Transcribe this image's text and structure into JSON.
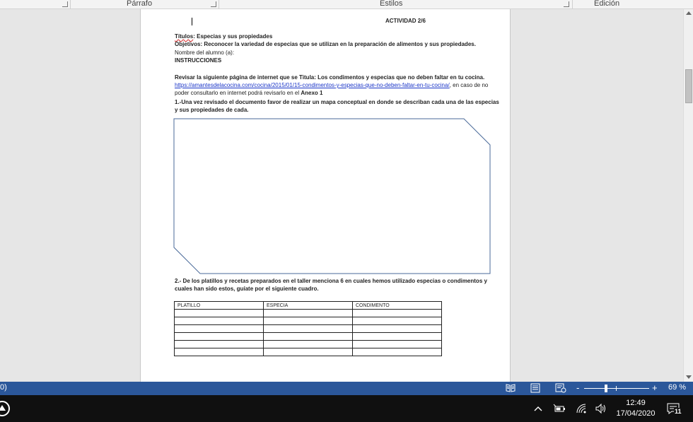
{
  "ribbon": {
    "groups": [
      {
        "label": "Párrafo"
      },
      {
        "label": "Estilos"
      },
      {
        "label": "Edición"
      }
    ]
  },
  "document": {
    "header_activity": "ACTIVIDAD 2/6",
    "title_label": "Títulos",
    "title_text": ": Especias y sus propiedades",
    "objectives_label": "Objetivos:",
    "objectives_text": " Reconocer la variedad de especias que se utilizan en la preparación de alimentos y sus propiedades.",
    "student_name_label": "Nombre del alumno (a):",
    "instructions_heading": "INSTRUCCIONES",
    "review_text": "Revisar la siguiente página de internet que se Titula: Los condimentos y especias que no deben faltar en tu cocina.",
    "link_url": "https://amantesdelacocina.com/cocina/2015/01/15-condimentos-y-especias-que-no-deben-faltar-en-tu-cocina/",
    "link_after": ", en caso de no poder consultarlo en internet podrá revisarlo en el ",
    "annex": "Anexo 1",
    "q1": "1.-Una vez revisado el documento favor de realizar un mapa conceptual en donde se describan cada una de las especias y sus propiedades de cada.",
    "q2": "2.- De los platillos y recetas preparados en el taller menciona 6 en cuales hemos utilizado especias o condimentos y cuales han sido estos, guíate por el siguiente cuadro.",
    "table": {
      "headers": [
        "PLATILLO",
        "ESPECIA",
        "CONDIMENTO"
      ],
      "empty_rows": 6
    }
  },
  "statusbar": {
    "left_fragment": "0)",
    "view_icons": [
      "read-mode-icon",
      "print-layout-icon",
      "web-layout-icon"
    ],
    "zoom_minus": "-",
    "zoom_plus": "+",
    "zoom_percent": 69,
    "zoom_label": "69 %"
  },
  "taskbar": {
    "time": "12:49",
    "date": "17/04/2020",
    "notification_count": "11",
    "tray_icons": [
      "chevron-up-icon",
      "battery-icon",
      "wifi-icon",
      "speaker-icon",
      "action-center-icon"
    ]
  },
  "colors": {
    "statusbar_bg": "#2b579a",
    "link": "#1a35c8",
    "shape_stroke": "#4a6a99",
    "taskbar_bg": "#101010"
  }
}
